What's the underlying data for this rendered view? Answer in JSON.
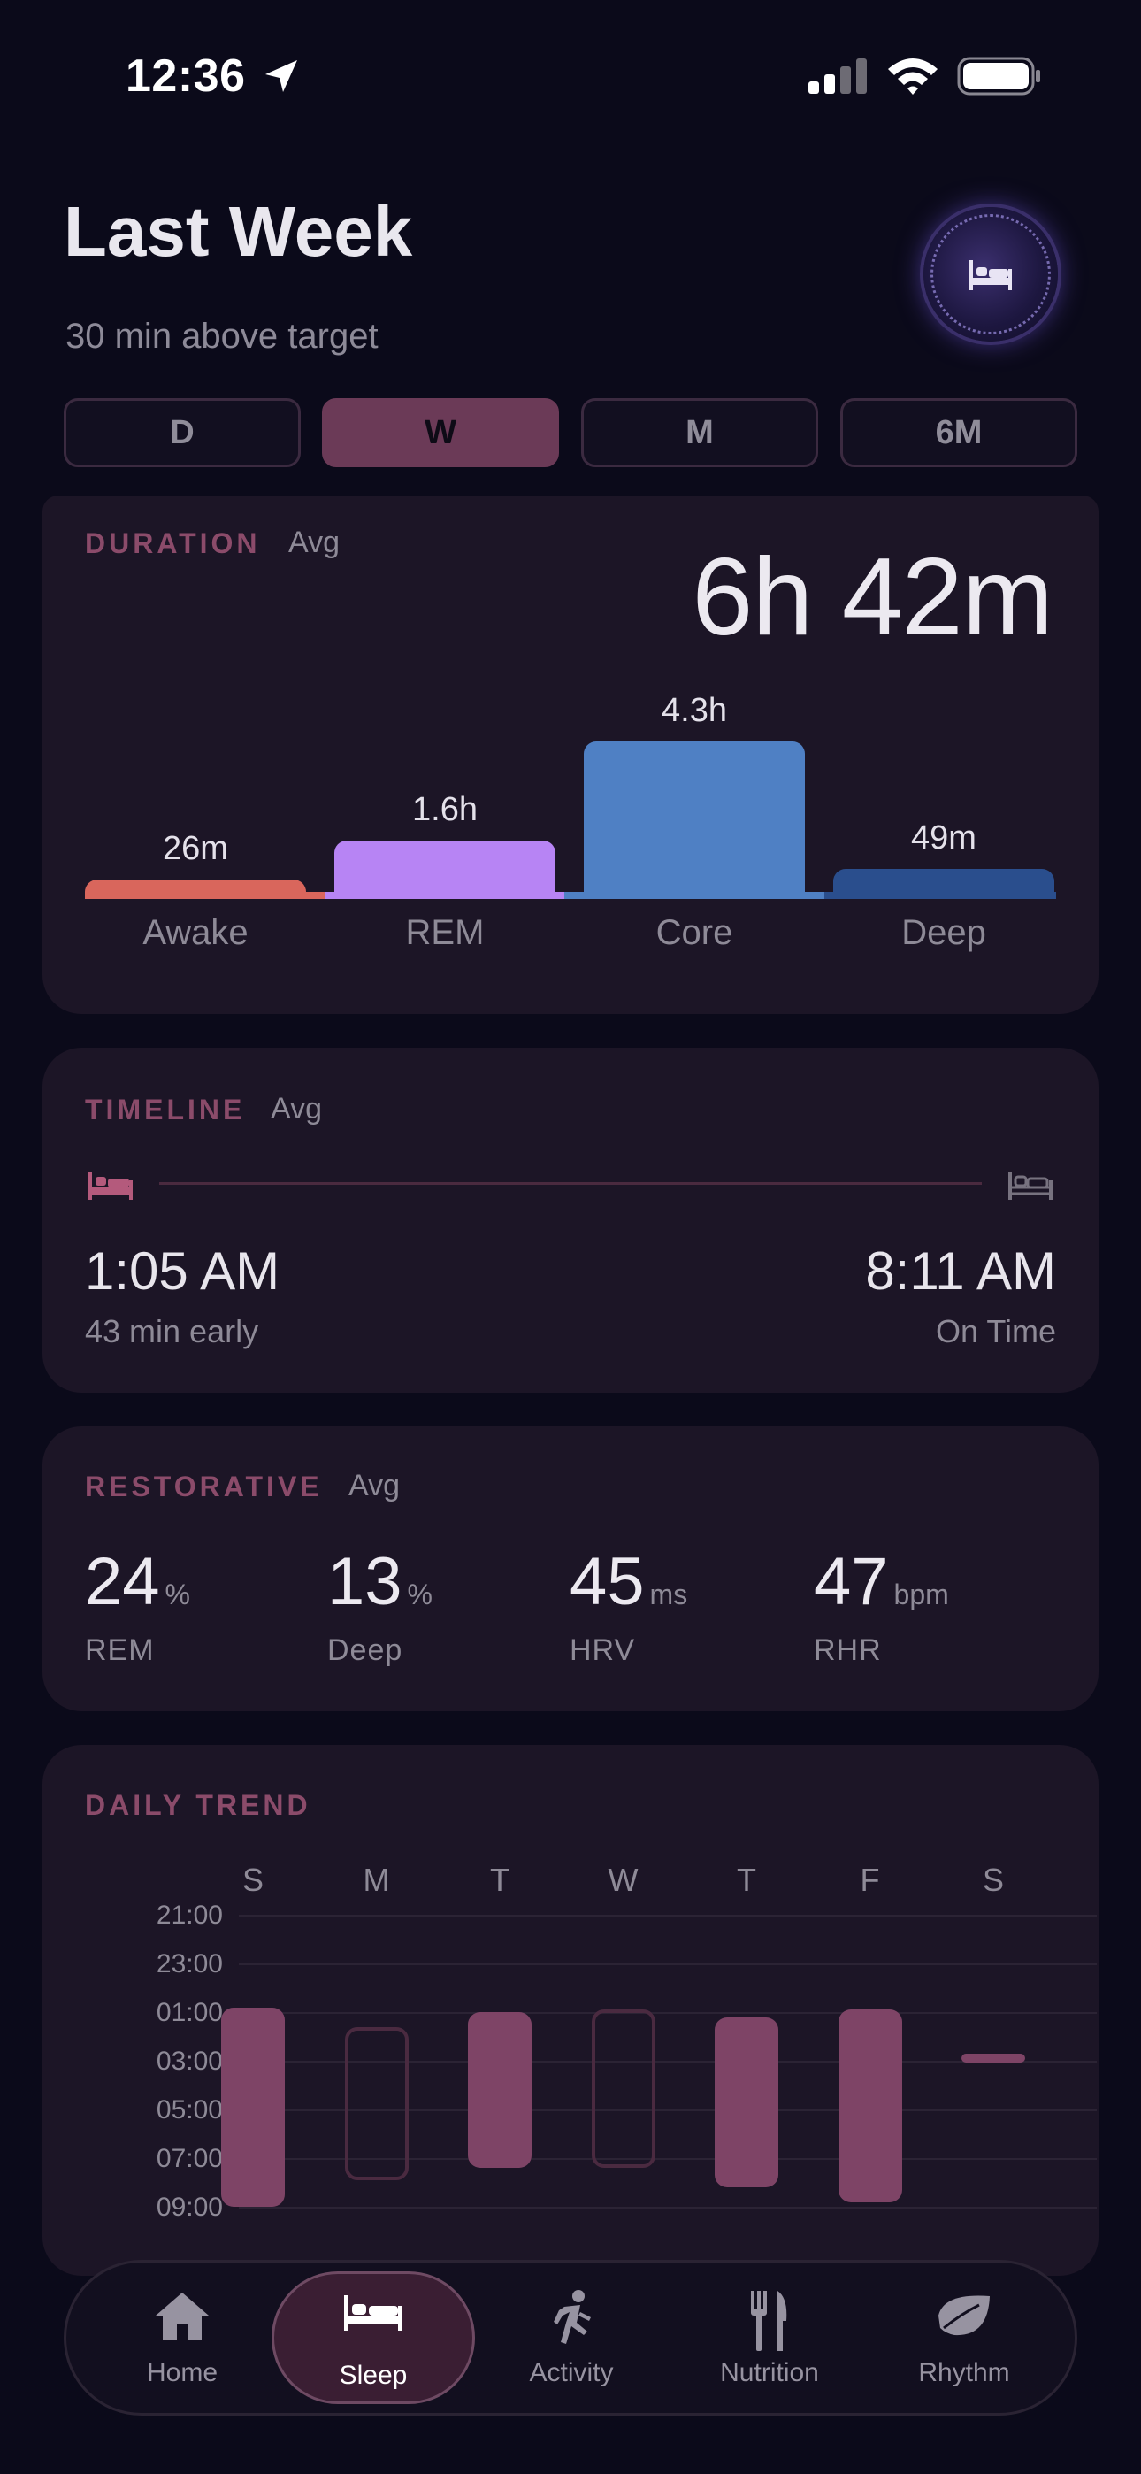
{
  "status_bar": {
    "time": "12:36"
  },
  "header": {
    "title": "Last Week",
    "subtitle": "30 min above target"
  },
  "segments": [
    {
      "label": "D",
      "active": false
    },
    {
      "label": "W",
      "active": true
    },
    {
      "label": "M",
      "active": false
    },
    {
      "label": "6M",
      "active": false
    }
  ],
  "duration": {
    "label": "DURATION",
    "avg_label": "Avg",
    "value": "6h 42m"
  },
  "chart_data": [
    {
      "type": "bar",
      "categories": [
        "Awake",
        "REM",
        "Core",
        "Deep"
      ],
      "values": [
        0.43,
        1.6,
        4.3,
        0.82
      ],
      "data_labels": [
        "26m",
        "1.6h",
        "4.3h",
        "49m"
      ],
      "colors": [
        "#d9665c",
        "#b784f4",
        "#4f80c4",
        "#2a4e8d"
      ],
      "ylim": [
        0,
        4.3
      ]
    },
    {
      "type": "bar",
      "title": "DAILY TREND",
      "categories": [
        "S",
        "M",
        "T",
        "W",
        "T",
        "F",
        "S"
      ],
      "y_ticks": [
        "21:00",
        "23:00",
        "01:00",
        "03:00",
        "05:00",
        "07:00",
        "09:00"
      ],
      "bars": [
        {
          "start_hour": 0.8,
          "end_hour": 9.0,
          "style": "filled"
        },
        {
          "start_hour": 1.6,
          "end_hour": 7.9,
          "style": "outline"
        },
        {
          "start_hour": 1.0,
          "end_hour": 7.4,
          "style": "filled"
        },
        {
          "start_hour": 0.9,
          "end_hour": 7.4,
          "style": "outline"
        },
        {
          "start_hour": 1.2,
          "end_hour": 8.2,
          "style": "filled"
        },
        {
          "start_hour": 0.9,
          "end_hour": 8.8,
          "style": "filled"
        },
        {
          "start_hour": 2.9,
          "end_hour": 3.1,
          "style": "dash"
        }
      ],
      "color": "#7e4466"
    }
  ],
  "timeline": {
    "label": "TIMELINE",
    "avg_label": "Avg",
    "bedtime": "1:05 AM",
    "bedtime_note": "43 min early",
    "wake": "8:11 AM",
    "wake_note": "On Time"
  },
  "restorative": {
    "label": "RESTORATIVE",
    "avg_label": "Avg",
    "metrics": [
      {
        "value": "24",
        "unit": "%",
        "label": "REM"
      },
      {
        "value": "13",
        "unit": "%",
        "label": "Deep"
      },
      {
        "value": "45",
        "unit": "ms",
        "label": "HRV"
      },
      {
        "value": "47",
        "unit": "bpm",
        "label": "RHR"
      }
    ]
  },
  "trend": {
    "label": "DAILY TREND"
  },
  "tabs": [
    {
      "label": "Home",
      "icon": "house-icon",
      "active": false
    },
    {
      "label": "Sleep",
      "icon": "bed-icon",
      "active": true
    },
    {
      "label": "Activity",
      "icon": "running-icon",
      "active": false
    },
    {
      "label": "Nutrition",
      "icon": "fork-knife-icon",
      "active": false
    },
    {
      "label": "Rhythm",
      "icon": "leaf-icon",
      "active": false
    }
  ]
}
